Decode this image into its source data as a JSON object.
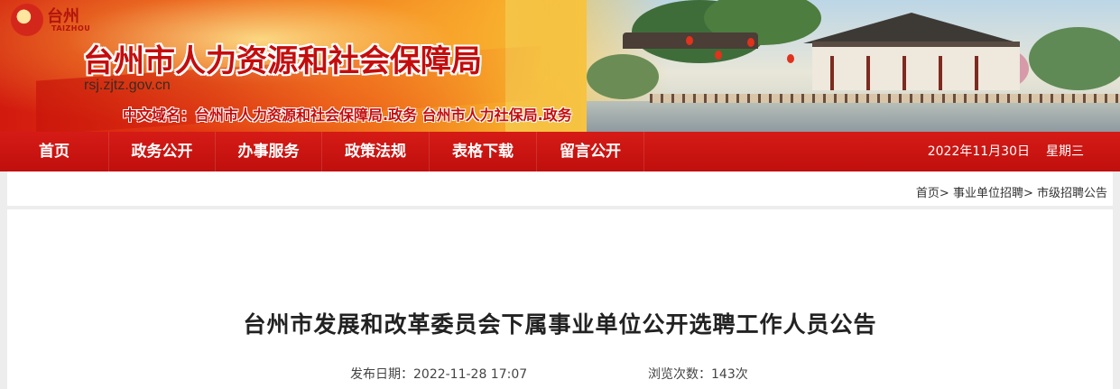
{
  "logo": {
    "cn": "台州",
    "en": "TAIZHOU"
  },
  "banner": {
    "title": "台州市人力资源和社会保障局",
    "domain": "rsj.zjtz.gov.cn",
    "cn_domain": "中文域名：台州市人力资源和社会保障局.政务   台州市人力社保局.政务"
  },
  "nav": {
    "items": [
      "首页",
      "政务公开",
      "办事服务",
      "政策法规",
      "表格下载",
      "留言公开"
    ],
    "date": "2022年11月30日",
    "weekday": "星期三"
  },
  "breadcrumb": [
    "首页>",
    "事业单位招聘>",
    "市级招聘公告"
  ],
  "article": {
    "title": "台州市发展和改革委员会下属事业单位公开选聘工作人员公告",
    "publish_date": "发布日期：2022-11-28 17:07",
    "view_count": "浏览次数：143次"
  }
}
